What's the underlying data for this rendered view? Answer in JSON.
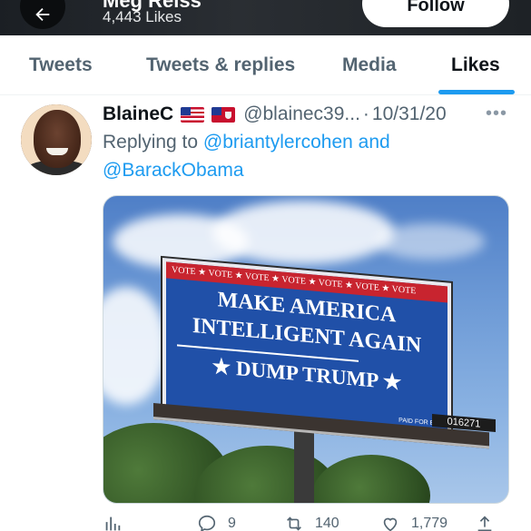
{
  "header": {
    "profile_name": "Meg Reiss",
    "likes_count": "4,443 Likes",
    "follow_label": "Follow",
    "back_icon": "arrow-left-icon"
  },
  "tabs": [
    {
      "label": "Tweets",
      "active": false
    },
    {
      "label": "Tweets & replies",
      "active": false
    },
    {
      "label": "Media",
      "active": false
    },
    {
      "label": "Likes",
      "active": true
    }
  ],
  "tweet": {
    "author_name": "BlaineC",
    "flags": [
      "flag-us-icon",
      "flag-bermuda-icon"
    ],
    "handle": "@blainec39...",
    "separator": "·",
    "date": "10/31/20",
    "more_icon": "more-horizontal-icon",
    "reply_prefix": "Replying to",
    "reply_mention_1": "@briantylercohen",
    "reply_connector": "and",
    "reply_mention_2": "@BarackObama",
    "image": {
      "board_stripe": "VOTE ★ VOTE ★ VOTE ★ VOTE ★ VOTE ★ VOTE ★ VOTE",
      "line1": "MAKE AMERICA",
      "line2": "INTELLIGENT AGAIN",
      "line3": "★ DUMP TRUMP ★",
      "fine_print": "PAID FOR BY",
      "board_id": "016271"
    },
    "actions": {
      "analytics_icon": "analytics-icon",
      "reply_icon": "reply-icon",
      "reply_count": "9",
      "retweet_icon": "retweet-icon",
      "retweet_count": "140",
      "like_icon": "heart-icon",
      "like_count": "1,779",
      "share_icon": "share-icon"
    }
  },
  "colors": {
    "accent": "#1d9bf0",
    "secondary_text": "#536471",
    "primary_text": "#0f1419",
    "header_bg": "#1b1f24"
  }
}
